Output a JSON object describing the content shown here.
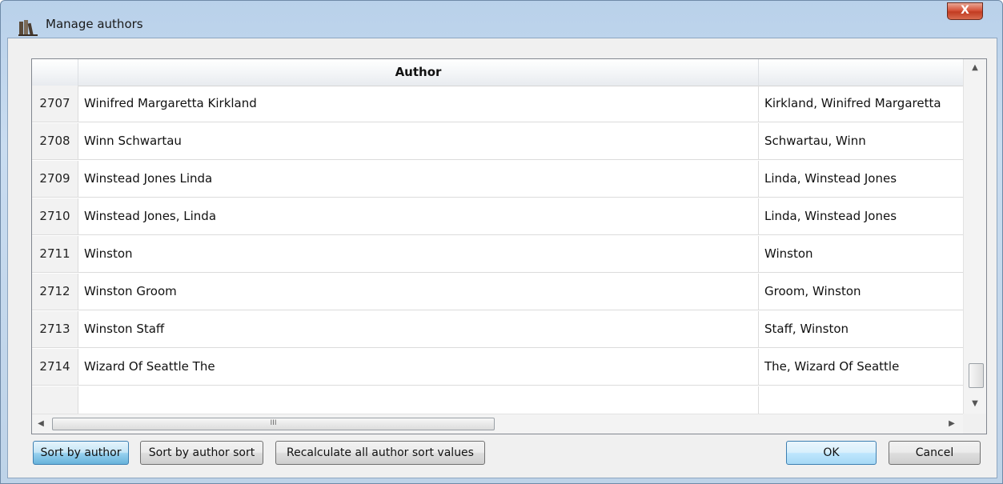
{
  "window": {
    "title": "Manage authors",
    "close_glyph": "X"
  },
  "table": {
    "headers": {
      "num": "",
      "author": "Author",
      "sort": ""
    },
    "rows": [
      {
        "num": "2707",
        "author": "Winifred Margaretta Kirkland",
        "sort": "Kirkland, Winifred Margaretta"
      },
      {
        "num": "2708",
        "author": "Winn Schwartau",
        "sort": "Schwartau, Winn"
      },
      {
        "num": "2709",
        "author": "Winstead Jones Linda",
        "sort": "Linda, Winstead Jones"
      },
      {
        "num": "2710",
        "author": "Winstead Jones, Linda",
        "sort": "Linda, Winstead Jones"
      },
      {
        "num": "2711",
        "author": "Winston",
        "sort": "Winston"
      },
      {
        "num": "2712",
        "author": "Winston Groom",
        "sort": "Groom, Winston"
      },
      {
        "num": "2713",
        "author": "Winston Staff",
        "sort": "Staff, Winston"
      },
      {
        "num": "2714",
        "author": "Wizard Of Seattle The",
        "sort": "The, Wizard Of Seattle"
      }
    ],
    "scroll": {
      "up": "▲",
      "down": "▼",
      "left": "◀",
      "right": "▶",
      "grip": "III"
    }
  },
  "buttons": {
    "sort_by_author": "Sort by author",
    "sort_by_author_sort": "Sort by author sort",
    "recalculate": "Recalculate all author sort values",
    "ok": "OK",
    "cancel": "Cancel"
  },
  "icons": {
    "app": "books-icon",
    "close": "close-icon"
  }
}
